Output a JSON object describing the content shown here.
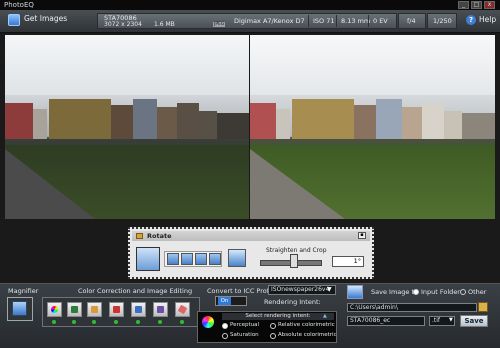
{
  "window": {
    "title": "PhotoEQ",
    "min": "_",
    "max": "□",
    "close": "x"
  },
  "toolbar": {
    "get_images": "Get Images",
    "file_name": "STA70086",
    "dimensions": "3072 x 2304",
    "file_size": "1.6 MB",
    "format_badge": "JPEG",
    "camera": "Digimax A7/Kenox D7",
    "iso": "ISO 71",
    "focal_length": "8.13 mm",
    "exposure_bias": "0 EV",
    "aperture": "f/4",
    "shutter": "1/250",
    "help": "Help"
  },
  "rotate": {
    "title": "Rotate",
    "straighten_label": "Straighten and Crop",
    "angle_value": "1",
    "degree_symbol": "°"
  },
  "bottom": {
    "magnifier_label": "Magnifier",
    "color_correction_label": "Color Correction and Image Editing",
    "convert_icc_label": "Convert to ICC Profile",
    "toggle_on": "On",
    "icc_profile": "ISOnewspaper26v4",
    "rendering_intent_label": "Rendering Intent:",
    "rendering_intent_header": "Select rendering intent:",
    "intents": [
      "Perceptual",
      "Relative colorimetric",
      "Saturation",
      "Absolute colorimetric"
    ],
    "save_image_label": "Save Image to",
    "save_options": [
      "Input Folder",
      "Other"
    ],
    "save_path": "C:\\Users\\admin\\",
    "output_filename": "STA70086_ec",
    "output_format": ".tif",
    "save_button": "Save"
  }
}
